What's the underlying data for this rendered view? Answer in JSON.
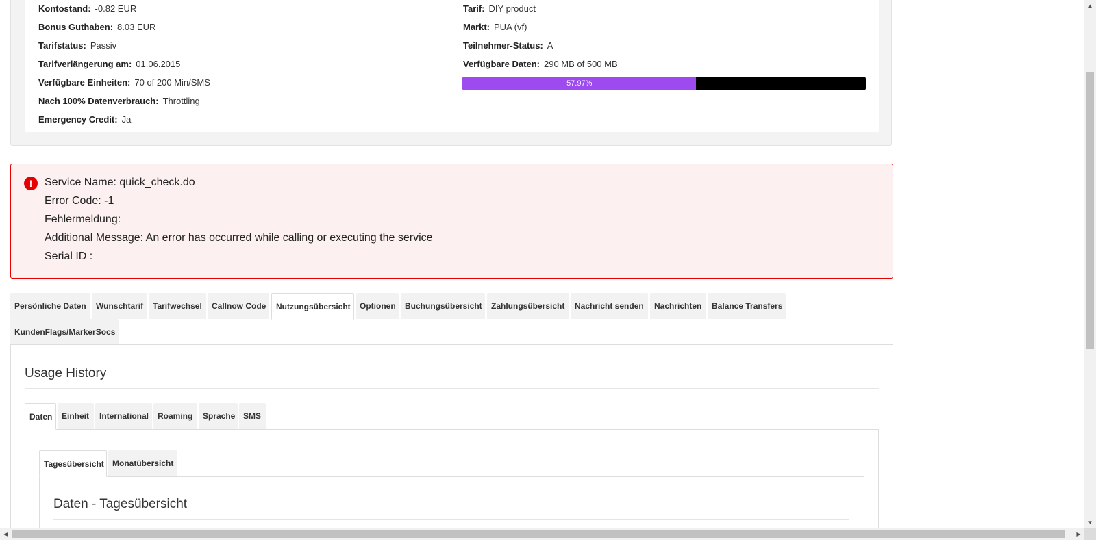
{
  "account_info": {
    "left": [
      {
        "label": "Kontostand:",
        "value": "-0.82 EUR"
      },
      {
        "label": "Bonus Guthaben:",
        "value": "8.03 EUR"
      },
      {
        "label": "Tarifstatus:",
        "value": "Passiv"
      },
      {
        "label": "Tarifverlängerung am:",
        "value": "01.06.2015"
      },
      {
        "label": "Verfügbare Einheiten:",
        "value": "70 of 200 Min/SMS"
      },
      {
        "label": "Nach 100% Datenverbrauch:",
        "value": "Throttling"
      },
      {
        "label": "Emergency Credit:",
        "value": "Ja"
      }
    ],
    "right": [
      {
        "label": "Tarif:",
        "value": "DIY product"
      },
      {
        "label": "Markt:",
        "value": "PUA (vf)"
      },
      {
        "label": "Teilnehmer-Status:",
        "value": "A"
      },
      {
        "label": "Verfügbare Daten:",
        "value": "290 MB of 500 MB"
      }
    ],
    "data_usage_progress": {
      "percent": 57.97,
      "label": "57.97%",
      "fill_color": "#9d4af0",
      "track_color": "#000000"
    }
  },
  "error": {
    "icon": "exclamation-circle-icon",
    "color": "#e60000",
    "lines": [
      "Service Name: quick_check.do",
      "Error Code: -1",
      "Fehlermeldung:",
      "Additional Message: An error has occurred while calling or executing the service",
      "Serial ID :"
    ]
  },
  "main_tabs": {
    "items": [
      "Persönliche Daten",
      "Wunschtarif",
      "Tarifwechsel",
      "Callnow Code",
      "Nutzungsübersicht",
      "Optionen",
      "Buchungsübersicht",
      "Zahlungsübersicht",
      "Nachricht senden",
      "Nachrichten",
      "Balance Transfers",
      "KundenFlags/MarkerSocs"
    ],
    "active": "Nutzungsübersicht"
  },
  "usage_history": {
    "title": "Usage History",
    "tabs": [
      "Daten",
      "Einheit",
      "International",
      "Roaming",
      "Sprache",
      "SMS"
    ],
    "active_tab": "Daten",
    "sub_tabs": [
      "Tagesübersicht",
      "Monatübersicht"
    ],
    "active_sub_tab": "Tagesübersicht",
    "section_title": "Daten - Tagesübersicht"
  },
  "scrollbars": {
    "up_arrow": "▲",
    "down_arrow": "▼",
    "left_arrow": "◀",
    "right_arrow": "▶"
  }
}
